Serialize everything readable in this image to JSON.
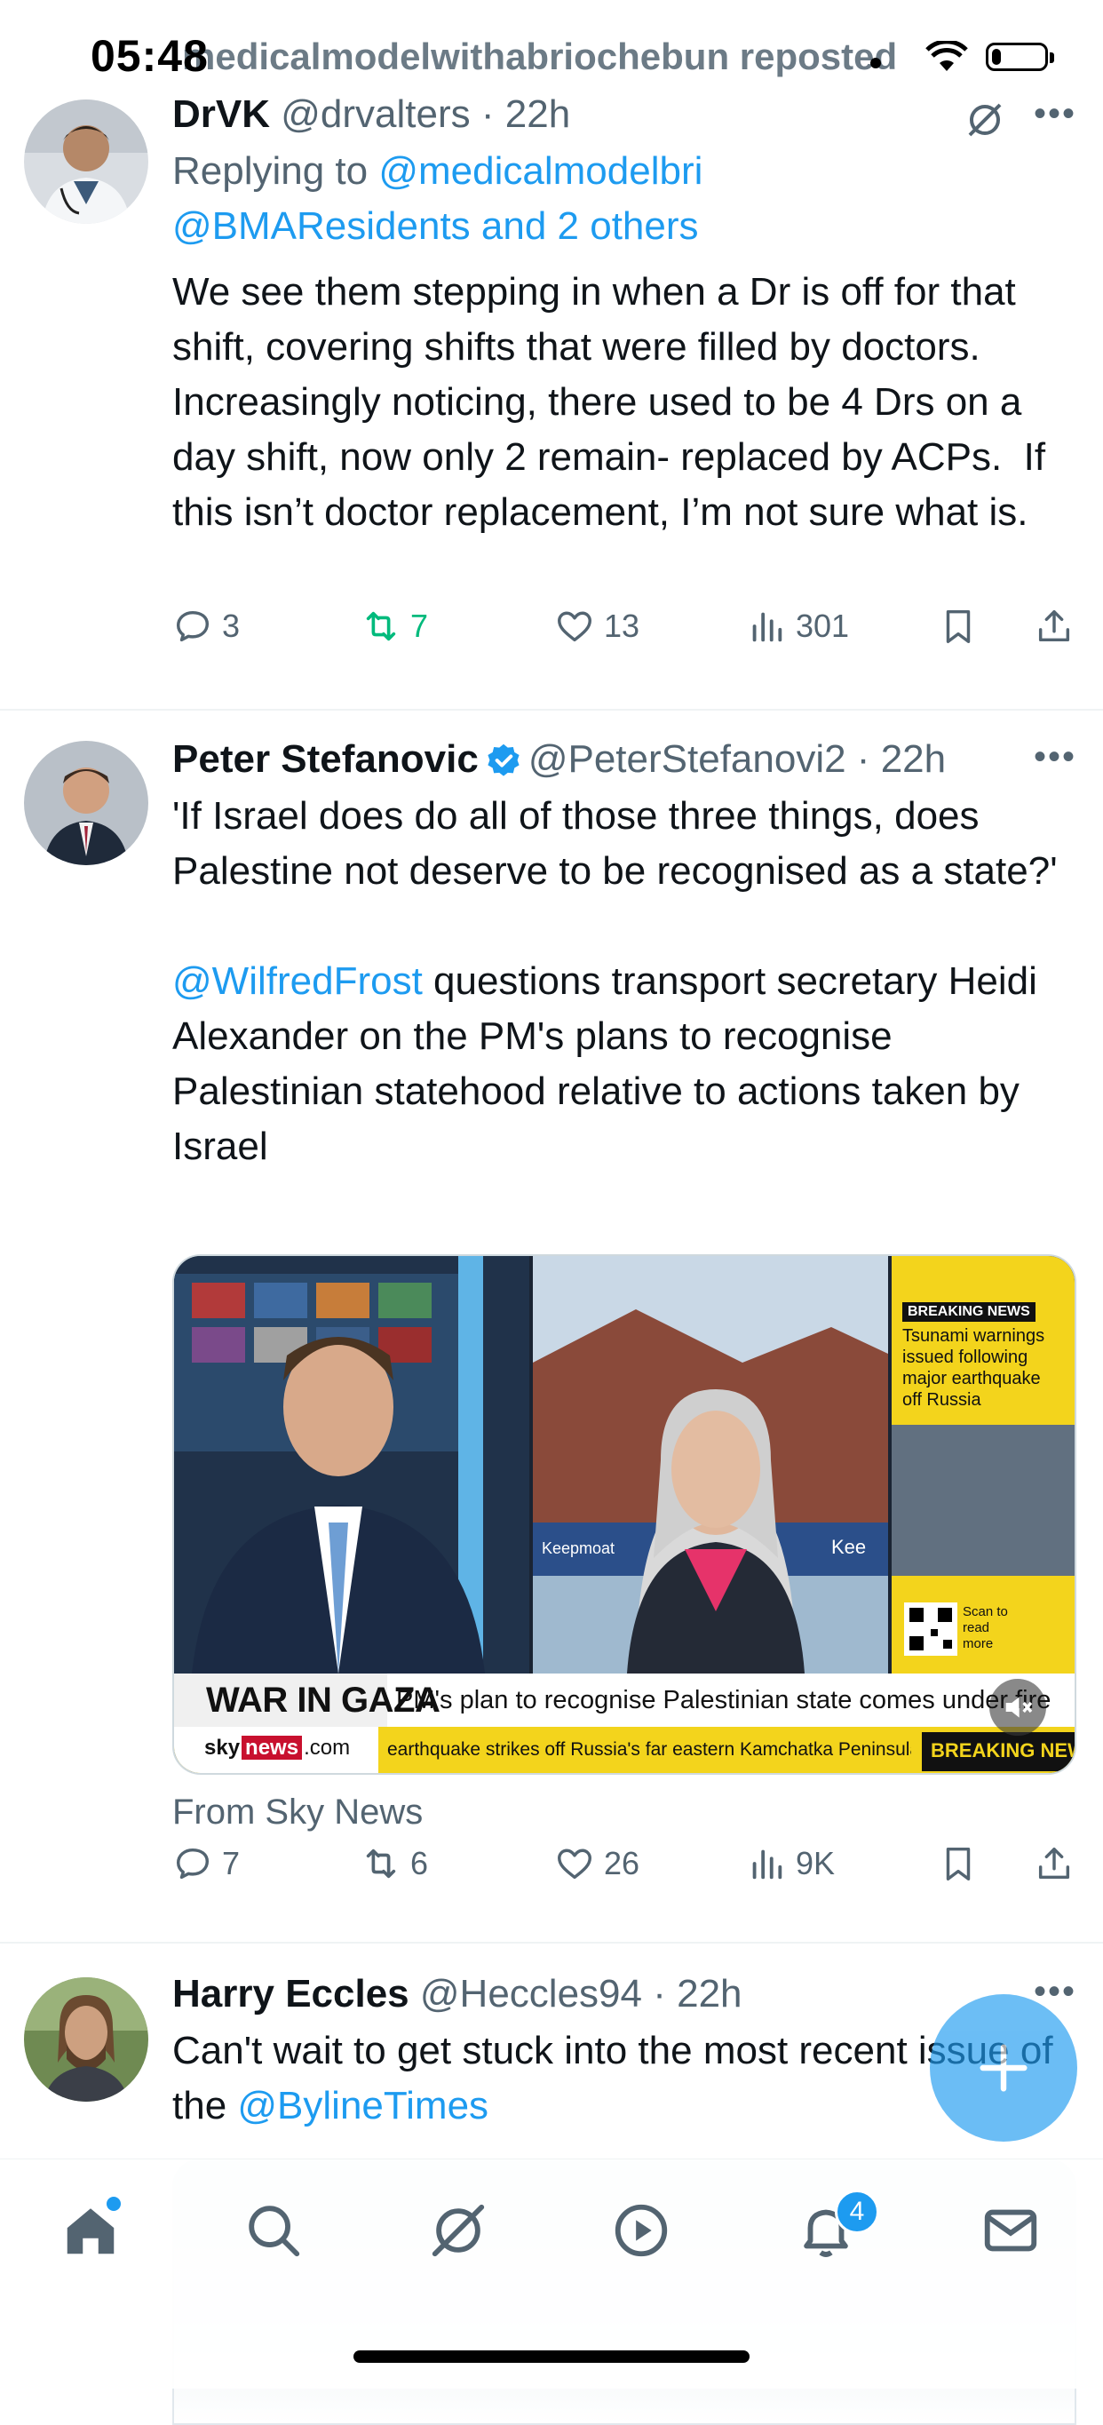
{
  "status": {
    "time": "05:48",
    "overlay_text": "medicalmodelwithabriochebun reposted",
    "battery_level": 0.18
  },
  "tweets": [
    {
      "name": "DrVK",
      "handle": "@drvalters",
      "time": "22h",
      "replying_prefix": "Replying to ",
      "replying_link1": "@medicalmodelbri",
      "replying_link2": "@BMAResidents and 2 others",
      "text": "We see them stepping in when a Dr is off for that shift, covering shifts that were filled by doctors. Increasingly noticing, there used to be 4 Drs on a day shift, now only 2 remain- replaced by ACPs.  If this isn’t doctor replacement, I’m not sure what is.",
      "replies": "3",
      "reposts": "7",
      "likes": "13",
      "views": "301"
    },
    {
      "name": "Peter Stefanovic",
      "handle": "@PeterStefanovi2",
      "time": "22h",
      "text_part1": "'If Israel does do all of those three things, does Palestine not deserve to be recognised as a state?'",
      "mention": "@WilfredFrost",
      "text_part2": " questions transport secretary Heidi Alexander on the PM's plans to recognise Palestinian statehood relative to actions taken by Israel",
      "media": {
        "breaking_label": "BREAKING NEWS",
        "breaking_text": "Tsunami warnings issued following major earthquake off Russia",
        "qr_text": "Scan to read more",
        "banner_title": "WAR IN GAZA",
        "banner_headline": "PM's plan to recognise Palestinian state comes under fire",
        "ticker": "earthquake strikes off Russia's far eastern Kamchatka Peninsula",
        "ticker_label": "BREAKING NEWS",
        "logo_sky": "sky",
        "logo_news": "news",
        "logo_com": ".com",
        "sign1": "Keepmoat",
        "sign2": "Kee"
      },
      "source": "From Sky News",
      "replies": "7",
      "reposts": "6",
      "likes": "26",
      "views": "9K"
    },
    {
      "name": "Harry Eccles",
      "handle": "@Heccles94",
      "time": "22h",
      "text_part1": "Can't wait to get stuck into the most recent issue of the ",
      "mention": "@BylineTimes"
    }
  ],
  "tabs": [
    "home-icon",
    "search-icon",
    "grok-icon",
    "video-icon",
    "notifications-icon",
    "messages-icon"
  ],
  "notification_count": "4",
  "colors": {
    "accent": "#1d9bf0",
    "repost_active": "#00ba7c",
    "muted": "#536471"
  }
}
